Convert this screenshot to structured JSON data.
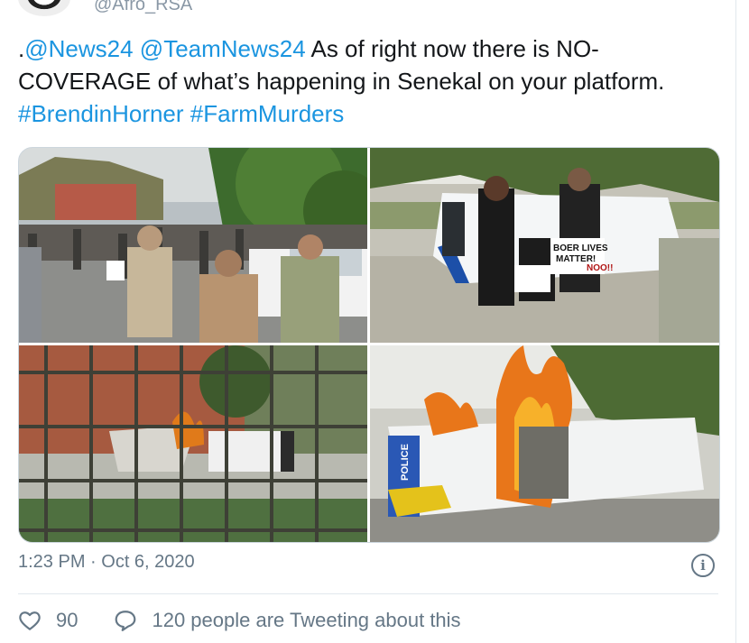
{
  "user": {
    "handle": "@Afro_RSA"
  },
  "tweet": {
    "mention1": "@News24",
    "mention2": "@TeamNews24",
    "text_prefix": ".",
    "text_main": " As of right now there is NO-COVERAGE of what’s happening in Senekal on your platform. ",
    "hashtag1": "#BrendinHorner",
    "hashtag2": "#FarmMurders"
  },
  "media": {
    "photo2_sign1": "BOER LIVES",
    "photo2_sign2": "MATTER!",
    "photo2_sign3": "NOO!!",
    "photo4_label": "POLICE"
  },
  "meta": {
    "time": "1:23 PM · Oct 6, 2020",
    "info_icon": "i"
  },
  "actions": {
    "likes": "90",
    "tweeting": "120 people are Tweeting about this"
  },
  "colors": {
    "link": "#1b95e0",
    "muted": "#657786",
    "border": "#e1e8ed"
  },
  "icons": [
    "heart-icon",
    "speech-bubble-icon",
    "info-icon"
  ]
}
